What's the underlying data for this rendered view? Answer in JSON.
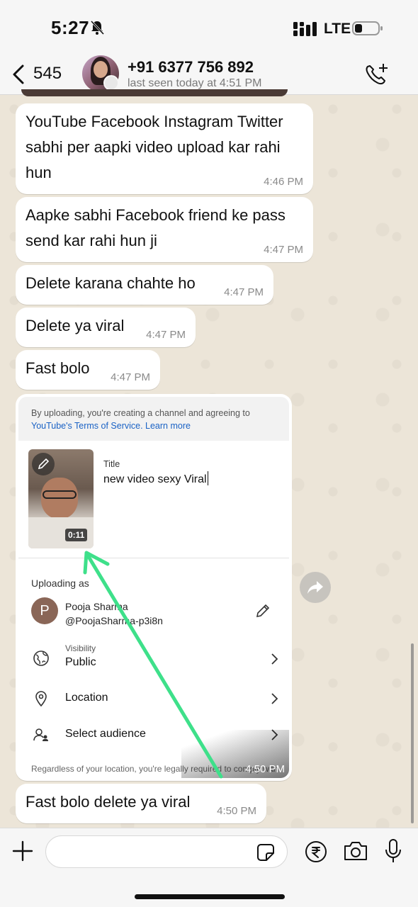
{
  "status_bar": {
    "time": "5:27",
    "network": "LTE"
  },
  "header": {
    "back_count": "545",
    "contact_name": "+91 6377 756 892",
    "last_seen": "last seen today at 4:51 PM"
  },
  "messages": [
    {
      "text": "YouTube Facebook Instagram Twitter sabhi per aapki video upload kar rahi hun",
      "time": "4:46 PM"
    },
    {
      "text": "Aapke sabhi Facebook friend ke pass send kar rahi hun ji",
      "time": "4:47 PM"
    },
    {
      "text": "Delete karana chahte ho",
      "time": "4:47 PM"
    },
    {
      "text": "Delete ya viral",
      "time": "4:47 PM"
    },
    {
      "text": "Fast bolo",
      "time": "4:47 PM"
    },
    {
      "text": "Fast bolo delete ya viral",
      "time": "4:50 PM"
    }
  ],
  "image_message": {
    "time": "4:50 PM",
    "notice_text": "By uploading, you're creating a channel and agreeing to",
    "notice_link": "YouTube's Terms of Service. Learn more",
    "duration": "0:11",
    "title_label": "Title",
    "title_value": "new video sexy Viral",
    "uploading_as_label": "Uploading as",
    "avatar_letter": "P",
    "account_name": "Pooja Sharma",
    "account_handle": "@PoojaSharma-p3i8n",
    "visibility_label": "Visibility",
    "visibility_value": "Public",
    "location_label": "Location",
    "audience_label": "Select audience",
    "footer_text": "Regardless of your location, you're legally required to comply with the US Children's Online Privacy Protection Act (COPPA)",
    "arrow_color": "#3ee08a"
  },
  "input": {
    "placeholder": ""
  },
  "colors": {
    "chat_bg": "#ece5d8",
    "bubble": "#ffffff",
    "link": "#1a62c5"
  }
}
